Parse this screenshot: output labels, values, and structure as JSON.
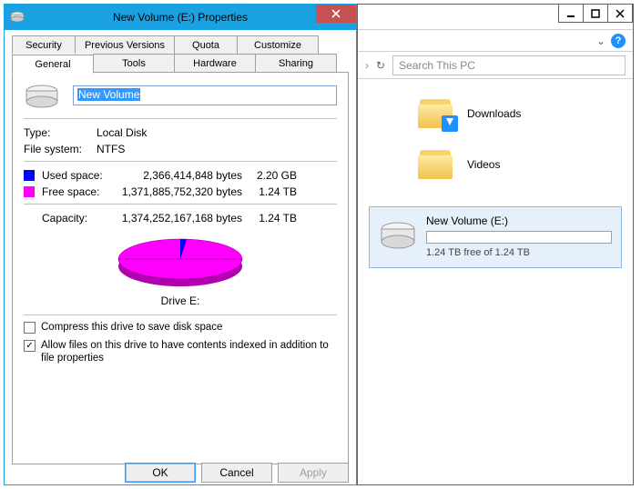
{
  "dialog": {
    "title": "New Volume (E:) Properties",
    "tabs_top": [
      "Security",
      "Previous Versions",
      "Quota",
      "Customize"
    ],
    "tabs_bottom": [
      "General",
      "Tools",
      "Hardware",
      "Sharing"
    ],
    "volume_name": "New Volume",
    "type_label": "Type:",
    "type_value": "Local Disk",
    "fs_label": "File system:",
    "fs_value": "NTFS",
    "used_label": "Used space:",
    "used_bytes": "2,366,414,848 bytes",
    "used_human": "2.20 GB",
    "free_label": "Free space:",
    "free_bytes": "1,371,885,752,320 bytes",
    "free_human": "1.24 TB",
    "cap_label": "Capacity:",
    "cap_bytes": "1,374,252,167,168 bytes",
    "cap_human": "1.24 TB",
    "drive_label": "Drive E:",
    "compress": "Compress this drive to save disk space",
    "index": "Allow files on this drive to have contents indexed in addition to file properties",
    "btn_ok": "OK",
    "btn_cancel": "Cancel",
    "btn_apply": "Apply"
  },
  "explorer": {
    "search_placeholder": "Search This PC",
    "folders": [
      {
        "label": "Downloads"
      },
      {
        "label": "Videos"
      }
    ],
    "drive": {
      "name": "New Volume (E:)",
      "free": "1.24 TB free of 1.24 TB"
    }
  }
}
